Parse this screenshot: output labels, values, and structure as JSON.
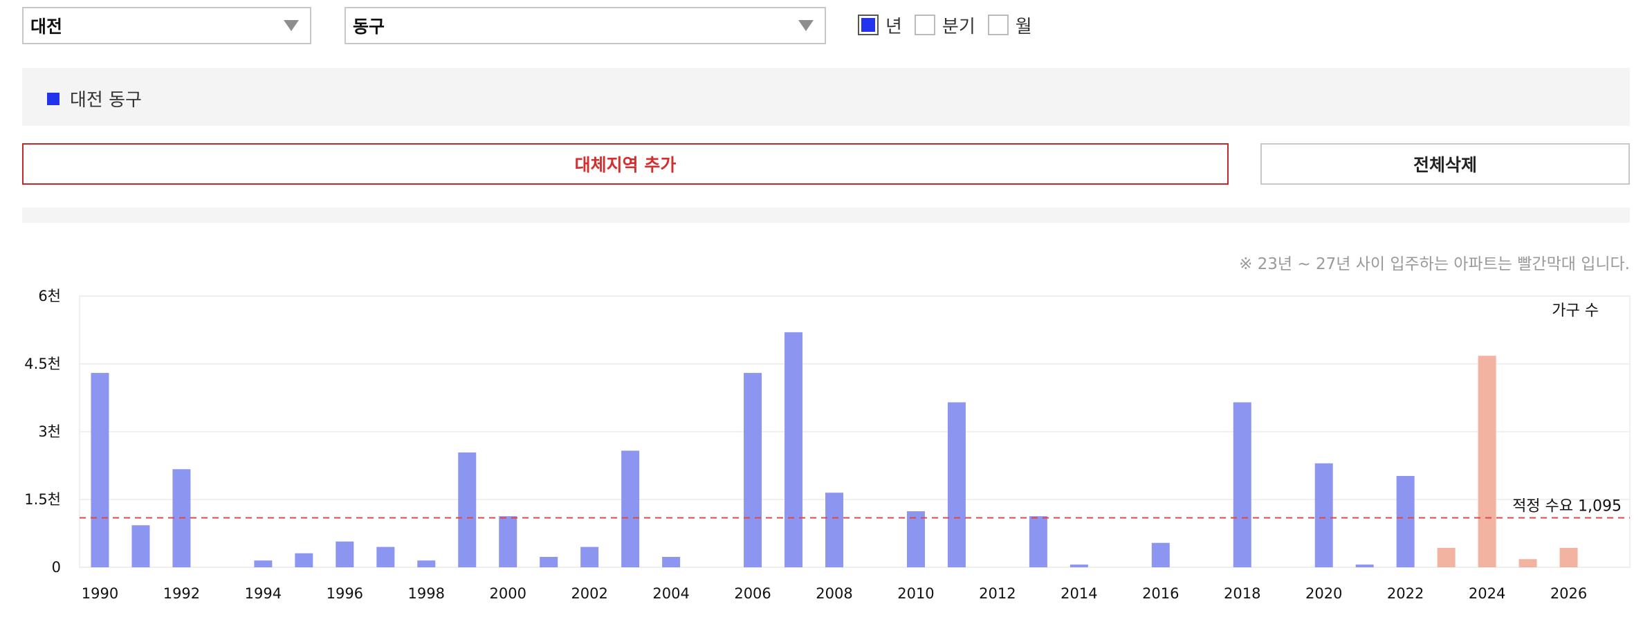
{
  "filters": {
    "city": "대전",
    "district": "동구",
    "periods": [
      {
        "label": "년",
        "checked": true
      },
      {
        "label": "분기",
        "checked": false
      },
      {
        "label": "월",
        "checked": false
      }
    ]
  },
  "legend": {
    "label": "대전 동구",
    "color": "#2233ee"
  },
  "buttons": {
    "add": "대체지역 추가",
    "clear": "전체삭제"
  },
  "note": "※ 23년 ~ 27년 사이 입주하는 아파트는 빨간막대 입니다.",
  "colors": {
    "bar": "#8c96f0",
    "forecast": "#f2b4a0",
    "reference": "#e04848"
  },
  "chart_data": {
    "type": "bar",
    "unit_label": "가구 수",
    "ylim": [
      0,
      6000
    ],
    "yticks": [
      {
        "value": 0,
        "label": "0"
      },
      {
        "value": 1500,
        "label": "1.5천"
      },
      {
        "value": 3000,
        "label": "3천"
      },
      {
        "value": 4500,
        "label": "4.5천"
      },
      {
        "value": 6000,
        "label": "6천"
      }
    ],
    "xtick_labels": [
      "1990",
      "1992",
      "1994",
      "1996",
      "1998",
      "2000",
      "2002",
      "2004",
      "2006",
      "2008",
      "2010",
      "2012",
      "2014",
      "2016",
      "2018",
      "2020",
      "2022",
      "2024",
      "2026"
    ],
    "categories": [
      "1990",
      "1991",
      "1992",
      "1993",
      "1994",
      "1995",
      "1996",
      "1997",
      "1998",
      "1999",
      "2000",
      "2001",
      "2002",
      "2003",
      "2004",
      "2005",
      "2006",
      "2007",
      "2008",
      "2009",
      "2010",
      "2011",
      "2012",
      "2013",
      "2014",
      "2015",
      "2016",
      "2017",
      "2018",
      "2019",
      "2020",
      "2021",
      "2022",
      "2023",
      "2024",
      "2025",
      "2026",
      "2027"
    ],
    "values": [
      4300,
      930,
      2170,
      0,
      150,
      310,
      570,
      450,
      150,
      2540,
      1130,
      230,
      450,
      2580,
      230,
      0,
      4300,
      5200,
      1650,
      0,
      1240,
      3650,
      0,
      1130,
      60,
      0,
      540,
      0,
      3650,
      0,
      2300,
      60,
      2020,
      430,
      4680,
      180,
      430,
      0
    ],
    "forecast_from": "2023",
    "reference_line": {
      "value": 1095,
      "label": "적정 수요 1,095"
    },
    "grid": true
  }
}
